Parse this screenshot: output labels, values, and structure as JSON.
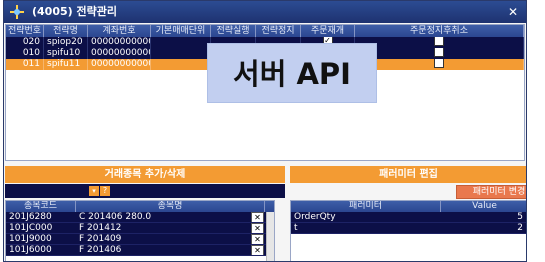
{
  "window": {
    "title": "(4005) 전략관리",
    "close_glyph": "✕"
  },
  "grid": {
    "columns": [
      "전략번호",
      "전략명",
      "계좌번호",
      "기본매매단위",
      "전략실행",
      "전략정지",
      "주문재개",
      "주문정지후취소"
    ],
    "rows": [
      {
        "num": "020",
        "name": "spiop20",
        "account": "00000000000",
        "order_resume": true,
        "cancel": false,
        "selected": false
      },
      {
        "num": "010",
        "name": "spifu10",
        "account": "00000000000",
        "order_resume": true,
        "cancel": false,
        "selected": false
      },
      {
        "num": "011",
        "name": "spifu11",
        "account": "00000000000",
        "order_resume": true,
        "cancel": false,
        "selected": true
      }
    ]
  },
  "overlay": {
    "text": "서버 API"
  },
  "left_panel": {
    "header": "거래종목 추가/삭제",
    "dropdown_glyph": "▾",
    "help_glyph": "?",
    "columns": [
      "종목코드",
      "종목명"
    ],
    "rows": [
      {
        "code": "201J6280",
        "name": "C 201406 280.0"
      },
      {
        "code": "101JC000",
        "name": "F 201412"
      },
      {
        "code": "101J9000",
        "name": "F 201409"
      },
      {
        "code": "101J6000",
        "name": "F 201406"
      }
    ],
    "delete_glyph": "✕"
  },
  "right_panel": {
    "header": "패러미터 편집",
    "change_button": "패러미터 변경",
    "columns": [
      "패러미터",
      "Value"
    ],
    "rows": [
      {
        "param": "OrderQty",
        "value": "5"
      },
      {
        "param": "t",
        "value": "2"
      }
    ]
  },
  "colors": {
    "title_bar": "#2c4c93",
    "grid_bg": "#0c0f47",
    "accent": "#f39b33",
    "overlay": "#c2cff0"
  }
}
